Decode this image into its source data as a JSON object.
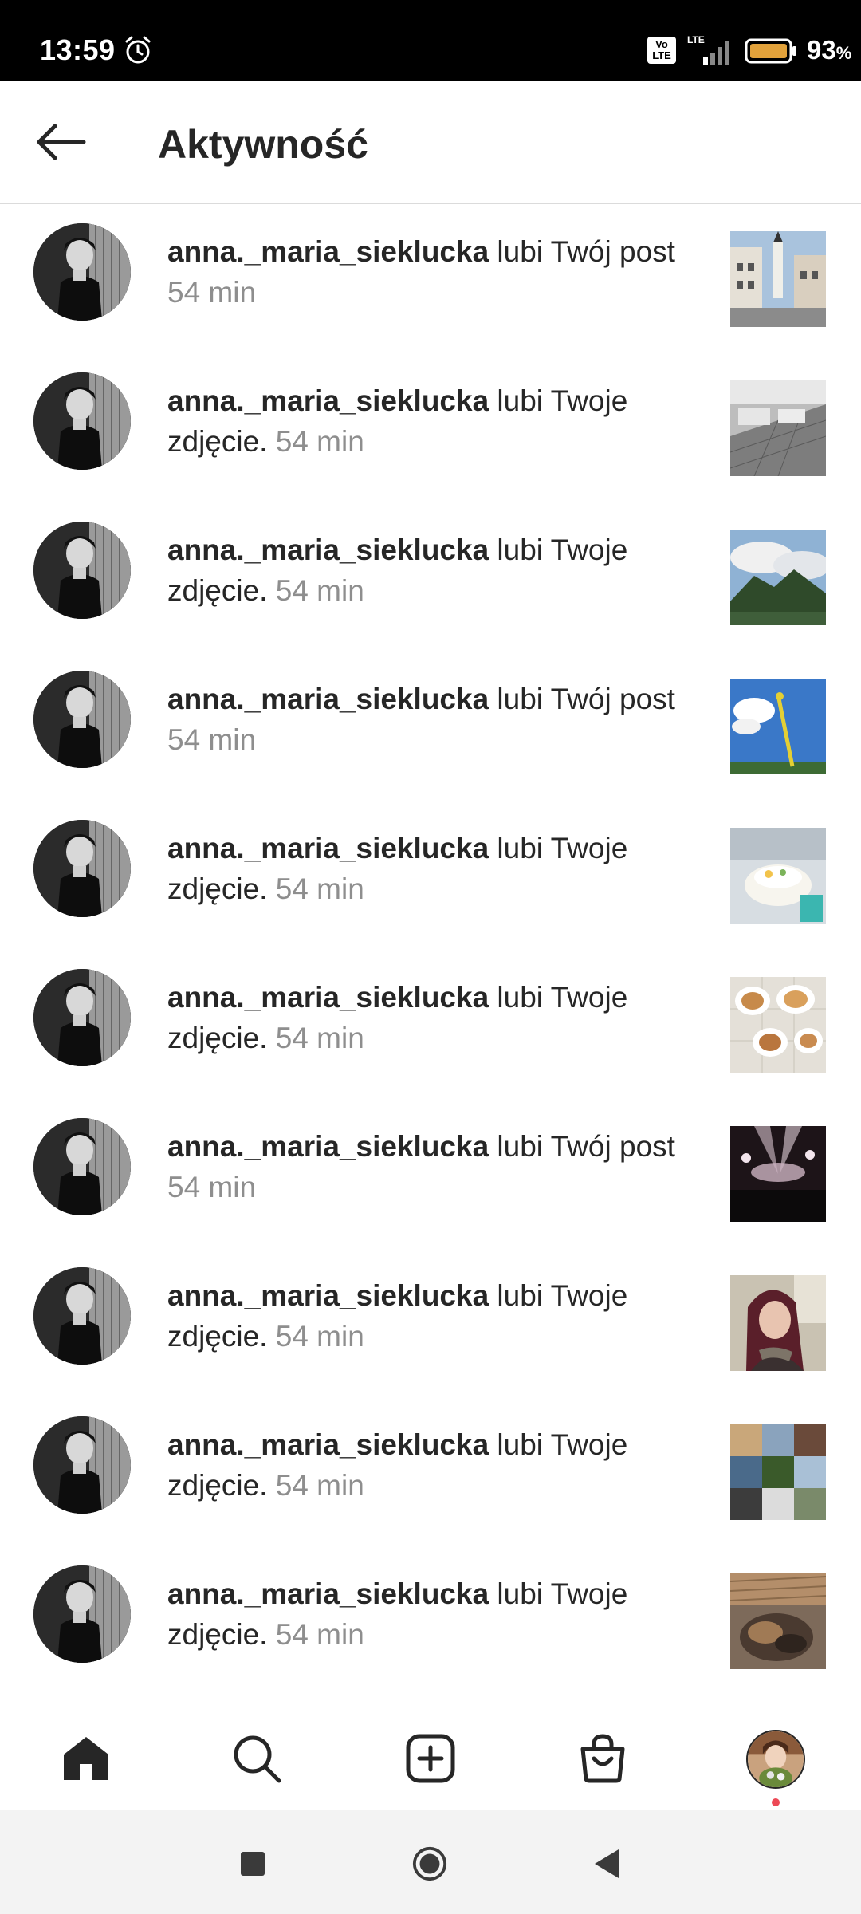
{
  "status_bar": {
    "time": "13:59",
    "network": "LTE",
    "volte": "Vo LTE",
    "battery": "93",
    "battery_unit": "%",
    "icons": [
      "alarm-icon",
      "volte-icon",
      "signal-icon",
      "battery-icon"
    ]
  },
  "header": {
    "title": "Aktywność",
    "back_icon": "arrow-left-icon"
  },
  "activity": [
    {
      "username": "anna._maria_sieklucka",
      "action": " lubi Twój post",
      "time": "54 min",
      "thumbnail": "town-street-church"
    },
    {
      "username": "anna._maria_sieklucka",
      "action": " lubi Twoje zdjęcie.",
      "time": "54 min",
      "thumbnail": "stone-wall-graffiti"
    },
    {
      "username": "anna._maria_sieklucka",
      "action": " lubi Twoje zdjęcie.",
      "time": "54 min",
      "thumbnail": "mountains-clouds"
    },
    {
      "username": "anna._maria_sieklucka",
      "action": " lubi Twój post",
      "time": "54 min",
      "thumbnail": "sky-yellow-pole"
    },
    {
      "username": "anna._maria_sieklucka",
      "action": " lubi Twoje zdjęcie.",
      "time": "54 min",
      "thumbnail": "birthday-cake"
    },
    {
      "username": "anna._maria_sieklucka",
      "action": " lubi Twoje zdjęcie.",
      "time": "54 min",
      "thumbnail": "food-plates"
    },
    {
      "username": "anna._maria_sieklucka",
      "action": " lubi Twój post",
      "time": "54 min",
      "thumbnail": "concert-stage"
    },
    {
      "username": "anna._maria_sieklucka",
      "action": " lubi Twoje zdjęcie.",
      "time": "54 min",
      "thumbnail": "selfie-woman"
    },
    {
      "username": "anna._maria_sieklucka",
      "action": " lubi Twoje zdjęcie.",
      "time": "54 min",
      "thumbnail": "photo-collage"
    },
    {
      "username": "anna._maria_sieklucka",
      "action": " lubi Twoje zdjęcie.",
      "time": "54 min",
      "thumbnail": "cat-sleeping"
    }
  ],
  "bottom_nav": {
    "items": [
      "home-icon",
      "search-icon",
      "new-post-icon",
      "shop-icon",
      "profile-avatar"
    ]
  },
  "system_nav": {
    "items": [
      "recents-button",
      "home-button",
      "back-button"
    ]
  },
  "colors": {
    "text": "#262626",
    "secondary_text": "#8e8e8e",
    "divider": "#dbdbdb",
    "notification_dot": "#ed4956"
  }
}
